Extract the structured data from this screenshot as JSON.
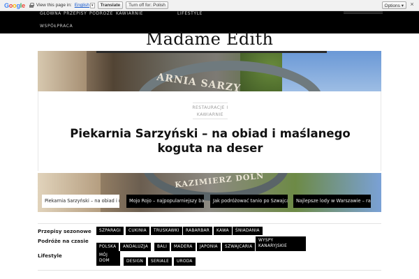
{
  "translate_bar": {
    "logo": "Google",
    "view_text": "View this page in:",
    "language": "English",
    "translate_label": "Translate",
    "turn_off_label": "Turn off for: Polish",
    "options_label": "Options ▾",
    "close_label": "×"
  },
  "nav": {
    "items": [
      "GŁÓWNA",
      "PRZEPISY",
      "PODRÓŻE",
      "KAWIARNIE",
      "LIFESTYLE",
      "WSPÓŁPRACA"
    ]
  },
  "site": {
    "title": "Madame Edith"
  },
  "article": {
    "category_line1": "RESTAURACJE I",
    "category_line2": "KAWIARNIE",
    "headline": "Piekarnia Sarzyński – na obiad i maślanego koguta na deser",
    "hero_sign_text": "ARNIA SARZY",
    "carousel_sign_text": "KAZIMIERZ DOLN"
  },
  "carousel": {
    "slides": [
      "Piekarnia Sarzyński – na obiad i maślanego koguta na deser",
      "Mojo Rojo – najpopularniejszy bar na Kazimierzu",
      "Jak podróżować tanio po Szwajcarii",
      "Najlepsze lody w Warszawie – ranking"
    ]
  },
  "tags": {
    "sections": [
      {
        "heading": "Przepisy sezonowe",
        "tags": [
          "SZPARAGI",
          "CUKINIA",
          "TRUSKAWKI",
          "RABARBAR",
          "KAWA",
          "ŚNIADANIA"
        ]
      },
      {
        "heading": "Podróże na czasie",
        "tags": [
          "POLSKA",
          "ANDALUZJA",
          "BALI",
          "MADERA",
          "JAPONIA",
          "SZWAJCARIA",
          "WYSPY KANARYJSKIE"
        ]
      },
      {
        "heading": "Lifestyle",
        "tags": [
          "MÓJ DOM",
          "DESIGN",
          "SERIALE",
          "URODA"
        ]
      }
    ]
  },
  "colors": {
    "navbar": "#000000",
    "tag_bg": "#000000",
    "tag_text": "#ffffff",
    "link_blue": "#1155cc"
  }
}
